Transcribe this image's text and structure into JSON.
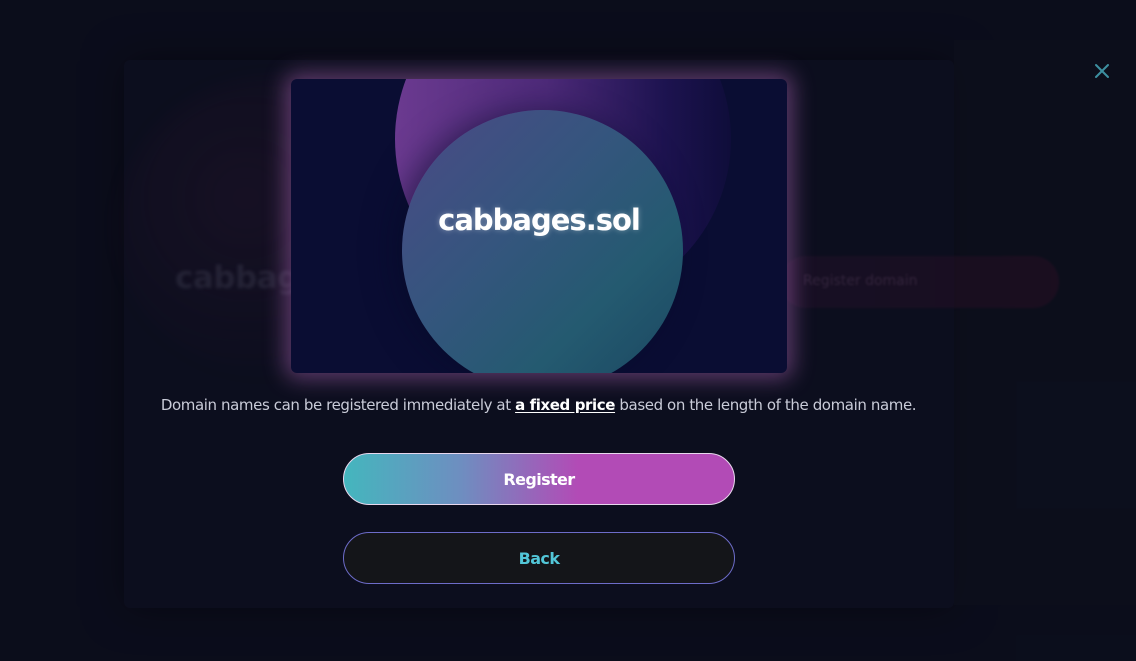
{
  "background": {
    "domain_text": "cabbages",
    "register_label": "Register domain"
  },
  "modal": {
    "close_icon": "close-icon",
    "card": {
      "domain_name": "cabbages.sol"
    },
    "info": {
      "prefix": "Domain names can be registered immediately at ",
      "link": "a fixed price",
      "suffix": " based on the length of the domain name."
    },
    "register_label": "Register",
    "back_label": "Back"
  },
  "colors": {
    "accent_teal": "#44b6be",
    "accent_magenta": "#b24bb6",
    "back_text": "#52c6d8",
    "back_border": "#6d6cc9",
    "close_icon": "#3d8fa0"
  }
}
